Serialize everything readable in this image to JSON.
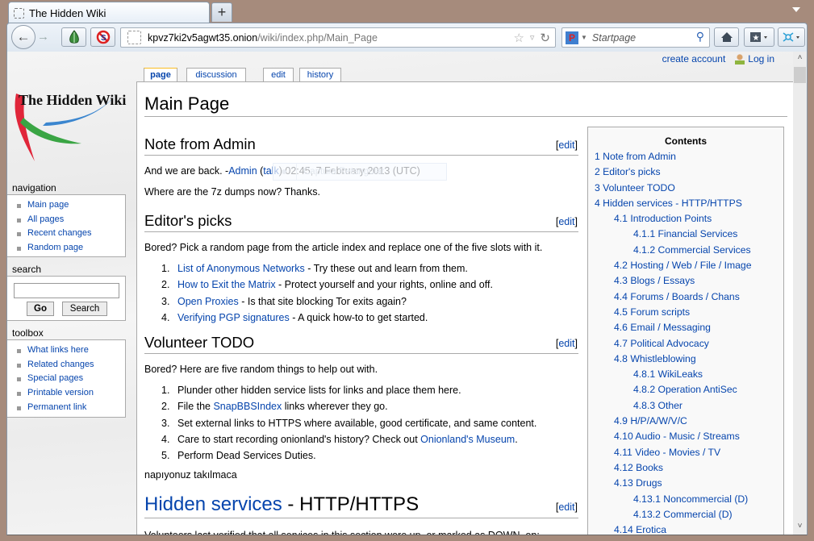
{
  "browser": {
    "tab_title": "The Hidden Wiki",
    "new_tab_label": "+",
    "url_host": "kpvz7ki2v5agwt35.onion",
    "url_path": "/wiki/index.php/Main_Page",
    "search_engine": "Startpage",
    "search_placeholder": "Startpage"
  },
  "personal_tools": {
    "create_account": "create account",
    "log_in": "Log in"
  },
  "logo_text": "The Hidden Wiki",
  "sidebar": {
    "navigation": {
      "heading": "navigation",
      "items": [
        {
          "label": "Main page"
        },
        {
          "label": "All pages"
        },
        {
          "label": "Recent changes"
        },
        {
          "label": "Random page"
        }
      ]
    },
    "search": {
      "heading": "search",
      "input_value": "",
      "go_label": "Go",
      "search_label": "Search"
    },
    "toolbox": {
      "heading": "toolbox",
      "items": [
        {
          "label": "What links here"
        },
        {
          "label": "Related changes"
        },
        {
          "label": "Special pages"
        },
        {
          "label": "Printable version"
        },
        {
          "label": "Permanent link"
        }
      ]
    }
  },
  "content_tabs": [
    {
      "label": "page",
      "selected": true
    },
    {
      "label": "discussion"
    },
    {
      "label": "edit"
    },
    {
      "label": "history"
    }
  ],
  "page": {
    "title": "Main Page",
    "edit_label": "edit",
    "sections": {
      "note": {
        "heading": "Note from Admin",
        "p1_prefix": "And we are back. -",
        "p1_admin": "Admin",
        "p1_open": " (",
        "p1_talk": "talk",
        "p1_suffix": ") 02:45, 7 February 2013 (UTC)",
        "p2": "Where are the 7z dumps now? Thanks."
      },
      "editors_picks": {
        "heading": "Editor's picks",
        "intro": "Bored? Pick a random page from the article index and replace one of the five slots with it.",
        "items": [
          {
            "num": "1.",
            "link": "List of Anonymous Networks",
            "text": " - Try these out and learn from them."
          },
          {
            "num": "2.",
            "link": "How to Exit the Matrix",
            "text": " - Protect yourself and your rights, online and off."
          },
          {
            "num": "3.",
            "link": "Open Proxies",
            "text": " - Is that site blocking Tor exits again?"
          },
          {
            "num": "4.",
            "link": "Verifying PGP signatures",
            "text": " - A quick how-to to get started."
          }
        ]
      },
      "volunteer": {
        "heading": "Volunteer TODO",
        "intro": "Bored? Here are five random things to help out with.",
        "items": [
          {
            "num": "1.",
            "pre": "Plunder other hidden service lists for links and place them here.",
            "link": "",
            "post": ""
          },
          {
            "num": "2.",
            "pre": "File the ",
            "link": "SnapBBSIndex",
            "post": " links wherever they go."
          },
          {
            "num": "3.",
            "pre": "Set external links to HTTPS where available, good certificate, and same content.",
            "link": "",
            "post": ""
          },
          {
            "num": "4.",
            "pre": "Care to start recording onionland's history? Check out ",
            "link": "Onionland's Museum",
            "post": "."
          },
          {
            "num": "5.",
            "pre": "Perform Dead Services Duties.",
            "link": "",
            "post": ""
          }
        ],
        "footer": "napıyonuz takılmaca"
      },
      "hidden_services": {
        "heading_link": "Hidden services",
        "heading_rest": " - HTTP/HTTPS",
        "intro_partial": "Volunteers last verified that all services in this section were up, or marked as DOWN, on:"
      }
    },
    "overlay": {
      "label": "Captura Retangular"
    }
  },
  "toc": {
    "title": "Contents",
    "items": [
      {
        "label": "1 Note from Admin",
        "level": 1
      },
      {
        "label": "2 Editor's picks",
        "level": 1
      },
      {
        "label": "3 Volunteer TODO",
        "level": 1
      },
      {
        "label": "4 Hidden services - HTTP/HTTPS",
        "level": 1
      },
      {
        "label": "4.1 Introduction Points",
        "level": 2
      },
      {
        "label": "4.1.1 Financial Services",
        "level": 3
      },
      {
        "label": "4.1.2 Commercial Services",
        "level": 3
      },
      {
        "label": "4.2 Hosting / Web / File / Image",
        "level": 2
      },
      {
        "label": "4.3 Blogs / Essays",
        "level": 2
      },
      {
        "label": "4.4 Forums / Boards / Chans",
        "level": 2
      },
      {
        "label": "4.5 Forum scripts",
        "level": 2
      },
      {
        "label": "4.6 Email / Messaging",
        "level": 2
      },
      {
        "label": "4.7 Political Advocacy",
        "level": 2
      },
      {
        "label": "4.8 Whistleblowing",
        "level": 2
      },
      {
        "label": "4.8.1 WikiLeaks",
        "level": 3
      },
      {
        "label": "4.8.2 Operation AntiSec",
        "level": 3
      },
      {
        "label": "4.8.3 Other",
        "level": 3
      },
      {
        "label": "4.9 H/P/A/W/V/C",
        "level": 2
      },
      {
        "label": "4.10 Audio - Music / Streams",
        "level": 2
      },
      {
        "label": "4.11 Video - Movies / TV",
        "level": 2
      },
      {
        "label": "4.12 Books",
        "level": 2
      },
      {
        "label": "4.13 Drugs",
        "level": 2
      },
      {
        "label": "4.13.1 Noncommercial (D)",
        "level": 3
      },
      {
        "label": "4.13.2 Commercial (D)",
        "level": 3
      },
      {
        "label": "4.14 Erotica",
        "level": 2
      }
    ]
  }
}
